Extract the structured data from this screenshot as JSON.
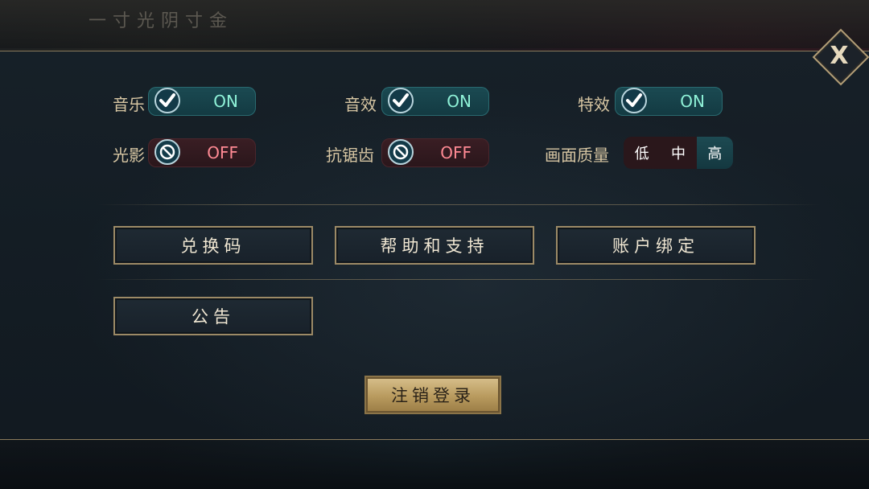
{
  "background": {
    "title": "一寸光阴寸金"
  },
  "close_button": {
    "label": "X"
  },
  "settings": {
    "music": {
      "label": "音乐",
      "state": "ON"
    },
    "sound": {
      "label": "音效",
      "state": "ON"
    },
    "effects": {
      "label": "特效",
      "state": "ON"
    },
    "lighting": {
      "label": "光影",
      "state": "OFF"
    },
    "antialias": {
      "label": "抗锯齿",
      "state": "OFF"
    },
    "quality": {
      "label": "画面质量",
      "options": [
        "低",
        "中",
        "高"
      ],
      "selected": "高"
    }
  },
  "buttons": {
    "redeem_code": "兑换码",
    "help_support": "帮助和支持",
    "account_bind": "账户绑定",
    "announcement": "公告",
    "logout": "注销登录"
  },
  "colors": {
    "on_text": "#8ff2d8",
    "off_text": "#ff8a94",
    "gold_border": "#9c8a66"
  }
}
